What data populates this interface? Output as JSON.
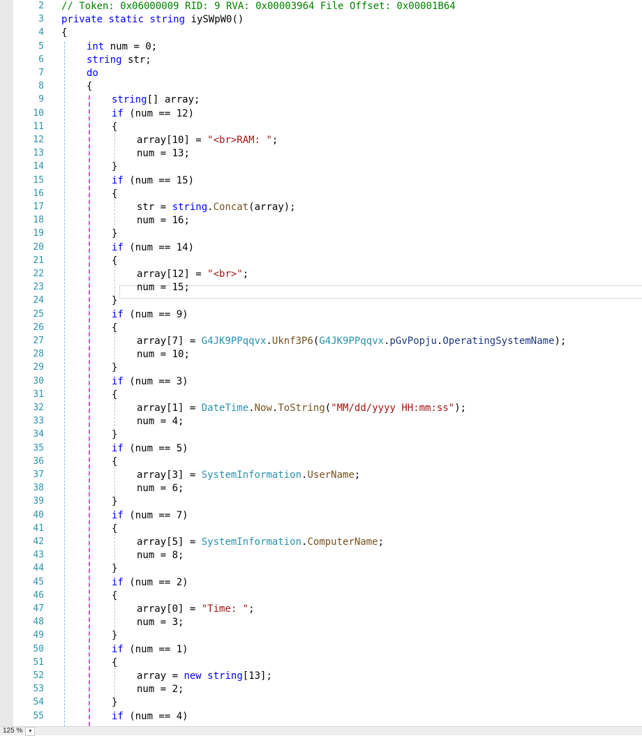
{
  "editor": {
    "lines": [
      {
        "n": "2",
        "indent": 0,
        "tokens": [
          [
            "cmt",
            "// Token: 0x06000009 RID: 9 RVA: 0x00003964 File Offset: 0x00001B64"
          ]
        ]
      },
      {
        "n": "3",
        "indent": 0,
        "tokens": [
          [
            "kw",
            "private"
          ],
          [
            "",
            " "
          ],
          [
            "kw",
            "static"
          ],
          [
            "",
            " "
          ],
          [
            "kw",
            "string"
          ],
          [
            "",
            " iySWpW0()"
          ]
        ]
      },
      {
        "n": "4",
        "indent": 0,
        "tokens": [
          [
            "",
            "{"
          ]
        ]
      },
      {
        "n": "5",
        "indent": 1,
        "tokens": [
          [
            "kw",
            "int"
          ],
          [
            "",
            " num = "
          ],
          [
            "num",
            "0"
          ],
          [
            "",
            ";"
          ]
        ]
      },
      {
        "n": "6",
        "indent": 1,
        "tokens": [
          [
            "kw",
            "string"
          ],
          [
            "",
            " str;"
          ]
        ]
      },
      {
        "n": "7",
        "indent": 1,
        "tokens": [
          [
            "kw",
            "do"
          ]
        ]
      },
      {
        "n": "8",
        "indent": 1,
        "tokens": [
          [
            "",
            "{"
          ]
        ]
      },
      {
        "n": "9",
        "indent": 2,
        "tokens": [
          [
            "kw",
            "string"
          ],
          [
            "",
            "[] array;"
          ]
        ]
      },
      {
        "n": "10",
        "indent": 2,
        "tokens": [
          [
            "kw",
            "if"
          ],
          [
            "",
            " (num == "
          ],
          [
            "num",
            "12"
          ],
          [
            "",
            ")"
          ]
        ]
      },
      {
        "n": "11",
        "indent": 2,
        "tokens": [
          [
            "",
            "{"
          ]
        ]
      },
      {
        "n": "12",
        "indent": 3,
        "tokens": [
          [
            "",
            "array["
          ],
          [
            "num",
            "10"
          ],
          [
            "",
            "] = "
          ],
          [
            "str",
            "\"<br>RAM: \""
          ],
          [
            "",
            ";"
          ]
        ]
      },
      {
        "n": "13",
        "indent": 3,
        "tokens": [
          [
            "",
            "num = "
          ],
          [
            "num",
            "13"
          ],
          [
            "",
            ";"
          ]
        ]
      },
      {
        "n": "14",
        "indent": 2,
        "tokens": [
          [
            "",
            "}"
          ]
        ]
      },
      {
        "n": "15",
        "indent": 2,
        "tokens": [
          [
            "kw",
            "if"
          ],
          [
            "",
            " (num == "
          ],
          [
            "num",
            "15"
          ],
          [
            "",
            ")"
          ]
        ]
      },
      {
        "n": "16",
        "indent": 2,
        "tokens": [
          [
            "",
            "{"
          ]
        ]
      },
      {
        "n": "17",
        "indent": 3,
        "tokens": [
          [
            "",
            "str = "
          ],
          [
            "kw",
            "string"
          ],
          [
            "",
            "."
          ],
          [
            "mth",
            "Concat"
          ],
          [
            "",
            "(array);"
          ]
        ]
      },
      {
        "n": "18",
        "indent": 3,
        "tokens": [
          [
            "",
            "num = "
          ],
          [
            "num",
            "16"
          ],
          [
            "",
            ";"
          ]
        ]
      },
      {
        "n": "19",
        "indent": 2,
        "tokens": [
          [
            "",
            "}"
          ]
        ]
      },
      {
        "n": "20",
        "indent": 2,
        "tokens": [
          [
            "kw",
            "if"
          ],
          [
            "",
            " (num == "
          ],
          [
            "num",
            "14"
          ],
          [
            "",
            ")"
          ]
        ]
      },
      {
        "n": "21",
        "indent": 2,
        "tokens": [
          [
            "",
            "{"
          ]
        ]
      },
      {
        "n": "22",
        "indent": 3,
        "tokens": [
          [
            "",
            "array["
          ],
          [
            "num",
            "12"
          ],
          [
            "",
            "] = "
          ],
          [
            "str",
            "\"<br>\""
          ],
          [
            "",
            ";"
          ]
        ]
      },
      {
        "n": "23",
        "indent": 3,
        "tokens": [
          [
            "",
            "num = "
          ],
          [
            "num",
            "15"
          ],
          [
            "",
            ";"
          ]
        ]
      },
      {
        "n": "24",
        "indent": 2,
        "tokens": [
          [
            "",
            "}"
          ]
        ]
      },
      {
        "n": "25",
        "indent": 2,
        "tokens": [
          [
            "kw",
            "if"
          ],
          [
            "",
            " (num == "
          ],
          [
            "num",
            "9"
          ],
          [
            "",
            ")"
          ]
        ]
      },
      {
        "n": "26",
        "indent": 2,
        "tokens": [
          [
            "",
            "{"
          ]
        ]
      },
      {
        "n": "27",
        "indent": 3,
        "tokens": [
          [
            "",
            "array["
          ],
          [
            "num",
            "7"
          ],
          [
            "",
            "] = "
          ],
          [
            "typ",
            "G4JK9PPqqvx"
          ],
          [
            "",
            "."
          ],
          [
            "mth",
            "Uknf3P6"
          ],
          [
            "",
            "("
          ],
          [
            "typ",
            "G4JK9PPqqvx"
          ],
          [
            "",
            "."
          ],
          [
            "prp",
            "pGvPopju"
          ],
          [
            "",
            "."
          ],
          [
            "prp",
            "OperatingSystemName"
          ],
          [
            "",
            ");"
          ]
        ]
      },
      {
        "n": "28",
        "indent": 3,
        "tokens": [
          [
            "",
            "num = "
          ],
          [
            "num",
            "10"
          ],
          [
            "",
            ";"
          ]
        ]
      },
      {
        "n": "29",
        "indent": 2,
        "tokens": [
          [
            "",
            "}"
          ]
        ]
      },
      {
        "n": "30",
        "indent": 2,
        "tokens": [
          [
            "kw",
            "if"
          ],
          [
            "",
            " (num == "
          ],
          [
            "num",
            "3"
          ],
          [
            "",
            ")"
          ]
        ]
      },
      {
        "n": "31",
        "indent": 2,
        "tokens": [
          [
            "",
            "{"
          ]
        ]
      },
      {
        "n": "32",
        "indent": 3,
        "tokens": [
          [
            "",
            "array["
          ],
          [
            "num",
            "1"
          ],
          [
            "",
            "] = "
          ],
          [
            "typ",
            "DateTime"
          ],
          [
            "",
            "."
          ],
          [
            "mth",
            "Now"
          ],
          [
            "",
            "."
          ],
          [
            "mth",
            "ToString"
          ],
          [
            "",
            "("
          ],
          [
            "str",
            "\"MM/dd/yyyy HH:mm:ss\""
          ],
          [
            "",
            ");"
          ]
        ]
      },
      {
        "n": "33",
        "indent": 3,
        "tokens": [
          [
            "",
            "num = "
          ],
          [
            "num",
            "4"
          ],
          [
            "",
            ";"
          ]
        ]
      },
      {
        "n": "34",
        "indent": 2,
        "tokens": [
          [
            "",
            "}"
          ]
        ]
      },
      {
        "n": "35",
        "indent": 2,
        "tokens": [
          [
            "kw",
            "if"
          ],
          [
            "",
            " (num == "
          ],
          [
            "num",
            "5"
          ],
          [
            "",
            ")"
          ]
        ]
      },
      {
        "n": "36",
        "indent": 2,
        "tokens": [
          [
            "",
            "{"
          ]
        ]
      },
      {
        "n": "37",
        "indent": 3,
        "tokens": [
          [
            "",
            "array["
          ],
          [
            "num",
            "3"
          ],
          [
            "",
            "] = "
          ],
          [
            "typ",
            "SystemInformation"
          ],
          [
            "",
            "."
          ],
          [
            "mth",
            "UserName"
          ],
          [
            "",
            ";"
          ]
        ]
      },
      {
        "n": "38",
        "indent": 3,
        "tokens": [
          [
            "",
            "num = "
          ],
          [
            "num",
            "6"
          ],
          [
            "",
            ";"
          ]
        ]
      },
      {
        "n": "39",
        "indent": 2,
        "tokens": [
          [
            "",
            "}"
          ]
        ]
      },
      {
        "n": "40",
        "indent": 2,
        "tokens": [
          [
            "kw",
            "if"
          ],
          [
            "",
            " (num == "
          ],
          [
            "num",
            "7"
          ],
          [
            "",
            ")"
          ]
        ]
      },
      {
        "n": "41",
        "indent": 2,
        "tokens": [
          [
            "",
            "{"
          ]
        ]
      },
      {
        "n": "42",
        "indent": 3,
        "tokens": [
          [
            "",
            "array["
          ],
          [
            "num",
            "5"
          ],
          [
            "",
            "] = "
          ],
          [
            "typ",
            "SystemInformation"
          ],
          [
            "",
            "."
          ],
          [
            "mth",
            "ComputerName"
          ],
          [
            "",
            ";"
          ]
        ]
      },
      {
        "n": "43",
        "indent": 3,
        "tokens": [
          [
            "",
            "num = "
          ],
          [
            "num",
            "8"
          ],
          [
            "",
            ";"
          ]
        ]
      },
      {
        "n": "44",
        "indent": 2,
        "tokens": [
          [
            "",
            "}"
          ]
        ]
      },
      {
        "n": "45",
        "indent": 2,
        "tokens": [
          [
            "kw",
            "if"
          ],
          [
            "",
            " (num == "
          ],
          [
            "num",
            "2"
          ],
          [
            "",
            ")"
          ]
        ]
      },
      {
        "n": "46",
        "indent": 2,
        "tokens": [
          [
            "",
            "{"
          ]
        ]
      },
      {
        "n": "47",
        "indent": 3,
        "tokens": [
          [
            "",
            "array["
          ],
          [
            "num",
            "0"
          ],
          [
            "",
            "] = "
          ],
          [
            "str",
            "\"Time: \""
          ],
          [
            "",
            ";"
          ]
        ]
      },
      {
        "n": "48",
        "indent": 3,
        "tokens": [
          [
            "",
            "num = "
          ],
          [
            "num",
            "3"
          ],
          [
            "",
            ";"
          ]
        ]
      },
      {
        "n": "49",
        "indent": 2,
        "tokens": [
          [
            "",
            "}"
          ]
        ]
      },
      {
        "n": "50",
        "indent": 2,
        "tokens": [
          [
            "kw",
            "if"
          ],
          [
            "",
            " (num == "
          ],
          [
            "num",
            "1"
          ],
          [
            "",
            ")"
          ]
        ]
      },
      {
        "n": "51",
        "indent": 2,
        "tokens": [
          [
            "",
            "{"
          ]
        ]
      },
      {
        "n": "52",
        "indent": 3,
        "tokens": [
          [
            "",
            "array = "
          ],
          [
            "kw",
            "new"
          ],
          [
            "",
            " "
          ],
          [
            "kw",
            "string"
          ],
          [
            "",
            "["
          ],
          [
            "num",
            "13"
          ],
          [
            "",
            "];"
          ]
        ]
      },
      {
        "n": "53",
        "indent": 3,
        "tokens": [
          [
            "",
            "num = "
          ],
          [
            "num",
            "2"
          ],
          [
            "",
            ";"
          ]
        ]
      },
      {
        "n": "54",
        "indent": 2,
        "tokens": [
          [
            "",
            "}"
          ]
        ]
      },
      {
        "n": "55",
        "indent": 2,
        "tokens": [
          [
            "kw",
            "if"
          ],
          [
            "",
            " (num == "
          ],
          [
            "num",
            "4"
          ],
          [
            "",
            ")"
          ]
        ]
      }
    ]
  },
  "statusbar": {
    "zoom_label": "125 %",
    "zoom_dropdown_icon": "chevron-down-icon"
  },
  "colors": {
    "keyword": "#0000ff",
    "string": "#a31515",
    "comment": "#008000",
    "type": "#2b91af",
    "method": "#74531f",
    "property": "#1f377f",
    "line_number": "#2b91af"
  }
}
